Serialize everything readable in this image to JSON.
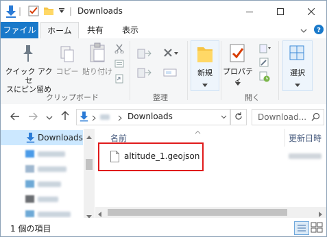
{
  "window": {
    "title": "Downloads",
    "separator": "|"
  },
  "tabs": [
    {
      "label": "ファイル"
    },
    {
      "label": "ホーム"
    },
    {
      "label": "共有"
    },
    {
      "label": "表示"
    }
  ],
  "ribbon": {
    "pin_label_1": "クイック アクセ",
    "pin_label_2": "スにピン留め",
    "copy_label": "コピー",
    "paste_label": "貼り付け",
    "group_clipboard": "クリップボード",
    "group_organize": "整理",
    "new_label": "新規",
    "properties_label": "プロパティ",
    "group_open": "開く",
    "select_label": "選択"
  },
  "address": {
    "folder": "Downloads",
    "search_placeholder": "Download..."
  },
  "nav": {
    "downloads_label": "Downloads"
  },
  "content": {
    "col_name": "名前",
    "col_modified": "更新日時",
    "files": [
      {
        "name": "altitude_1.geojson"
      }
    ]
  },
  "status": {
    "count_text": "1 個の項目"
  },
  "colors": {
    "accent": "#1979ca",
    "highlight_box": "#e0191a",
    "selected_nav": "#cce8ff"
  }
}
